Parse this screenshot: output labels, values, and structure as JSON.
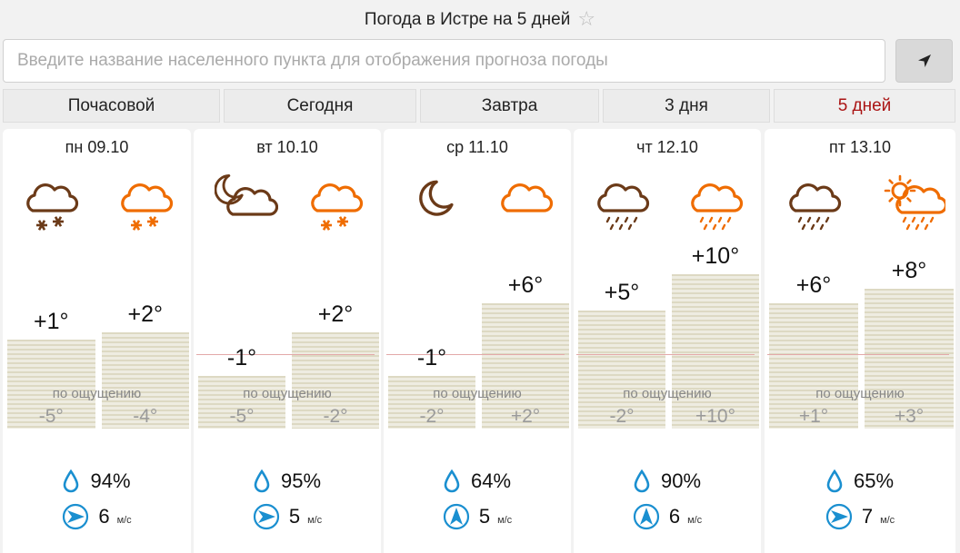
{
  "header": {
    "title": "Погода в Истре на 5 дней"
  },
  "search": {
    "placeholder": "Введите название населенного пункта для отображения прогноза погоды"
  },
  "tabs": [
    {
      "label": "Почасовой",
      "active": false
    },
    {
      "label": "Сегодня",
      "active": false
    },
    {
      "label": "Завтра",
      "active": false
    },
    {
      "label": "3 дня",
      "active": false
    },
    {
      "label": "5 дней",
      "active": true
    }
  ],
  "colors": {
    "active_tab": "#aa1414",
    "icon_dark": "#6b3a18",
    "icon_orange": "#ef6c00",
    "icon_blue": "#1a8fd0"
  },
  "feels_label": "по ощущению",
  "days": [
    {
      "date": "пн 09.10",
      "icons": [
        "cloud-snow-icon",
        "cloud-snow-icon"
      ],
      "night_temp": "+1°",
      "day_temp": "+2°",
      "night_feel": "-5°",
      "day_feel": "-4°",
      "night_value": 1,
      "day_value": 2,
      "humidity": "94%",
      "wind_speed": "6",
      "wind_unit": "м/с",
      "wind_dir": "west"
    },
    {
      "date": "вт 10.10",
      "icons": [
        "moon-cloud-icon",
        "cloud-snow-icon"
      ],
      "night_temp": "-1°",
      "day_temp": "+2°",
      "night_feel": "-5°",
      "day_feel": "-2°",
      "night_value": -1,
      "day_value": 2,
      "humidity": "95%",
      "wind_speed": "5",
      "wind_unit": "м/с",
      "wind_dir": "west"
    },
    {
      "date": "ср 11.10",
      "icons": [
        "moon-icon",
        "cloud-icon"
      ],
      "night_temp": "-1°",
      "day_temp": "+6°",
      "night_feel": "-2°",
      "day_feel": "+2°",
      "night_value": -1,
      "day_value": 6,
      "humidity": "64%",
      "wind_speed": "5",
      "wind_unit": "м/с",
      "wind_dir": "south"
    },
    {
      "date": "чт 12.10",
      "icons": [
        "cloud-rain-icon",
        "cloud-rain-icon"
      ],
      "night_temp": "+5°",
      "day_temp": "+10°",
      "night_feel": "-2°",
      "day_feel": "+10°",
      "night_value": 5,
      "day_value": 10,
      "humidity": "90%",
      "wind_speed": "6",
      "wind_unit": "м/с",
      "wind_dir": "south"
    },
    {
      "date": "пт 13.10",
      "icons": [
        "cloud-rain-icon",
        "sun-cloud-rain-icon"
      ],
      "night_temp": "+6°",
      "day_temp": "+8°",
      "night_feel": "+1°",
      "day_feel": "+3°",
      "night_value": 6,
      "day_value": 8,
      "humidity": "65%",
      "wind_speed": "7",
      "wind_unit": "м/с",
      "wind_dir": "west"
    }
  ]
}
